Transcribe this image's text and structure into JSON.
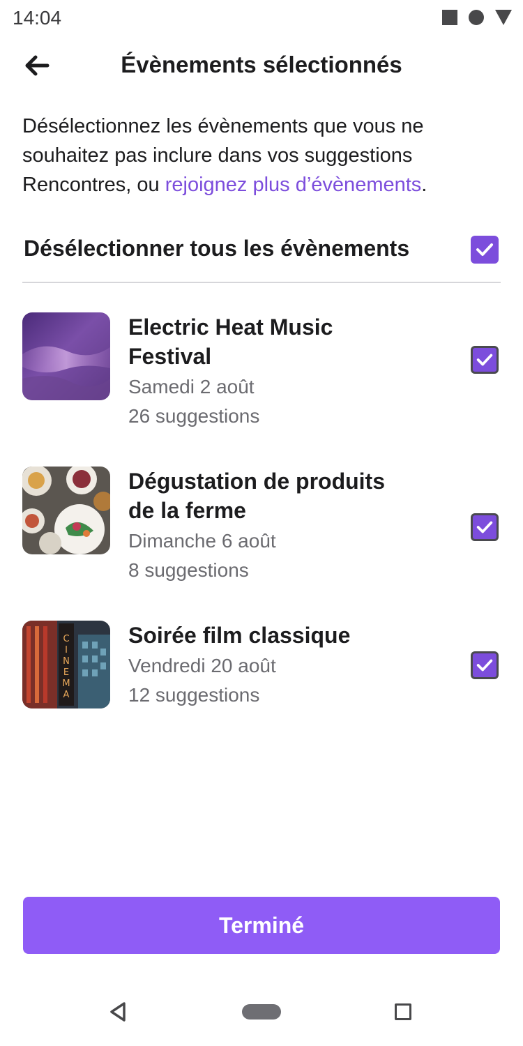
{
  "status_bar": {
    "time": "14:04",
    "icons": [
      "stop-square-icon",
      "record-circle-icon",
      "signal-triangle-icon"
    ]
  },
  "header": {
    "back_icon": "arrow-left-icon",
    "title": "Évènements sélectionnés"
  },
  "intro": {
    "text_before": "Désélectionnez les évènements que vous ne souhaitez pas inclure dans vos suggestions Rencontres, ou ",
    "link_text": "rejoignez plus d’évènements",
    "text_after": "."
  },
  "select_all": {
    "label": "Désélectionner tous les évènements",
    "checked": true
  },
  "events": [
    {
      "title": "Electric Heat Music Festival",
      "date": "Samedi 2 août",
      "suggestions": "26 suggestions",
      "checked": true,
      "image": "concert-image"
    },
    {
      "title": "Dégustation de produits de la ferme",
      "date": "Dimanche 6 août",
      "suggestions": "8 suggestions",
      "checked": true,
      "image": "food-plates-image"
    },
    {
      "title": "Soirée film classique",
      "date": "Vendredi 20 août",
      "suggestions": "12 suggestions",
      "checked": true,
      "image": "cinema-sign-image",
      "image_text": "CINEMA"
    }
  ],
  "done_button": {
    "label": "Terminé"
  },
  "nav_bar": {
    "icons": [
      "nav-back-icon",
      "nav-home-icon",
      "nav-recents-icon"
    ]
  },
  "colors": {
    "accent": "#7c4ddc",
    "button": "#8f5cf6",
    "text": "#1c1c1e",
    "secondary_text": "#6b6b70"
  }
}
